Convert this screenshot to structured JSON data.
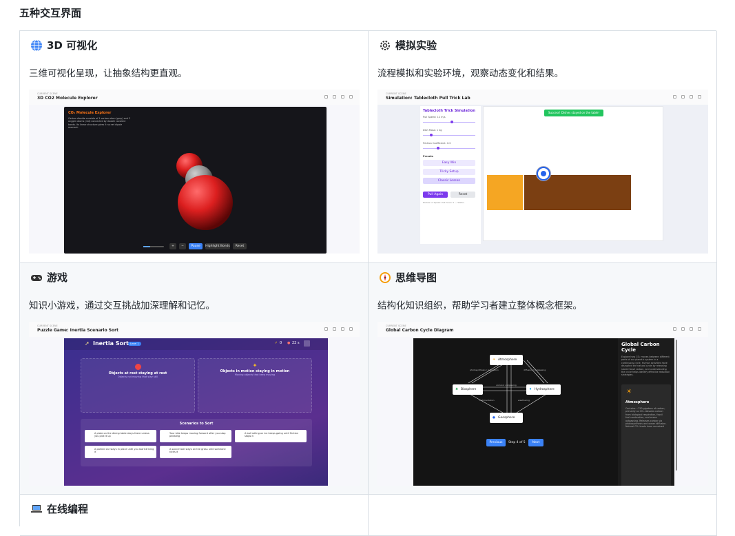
{
  "page_title": "五种交互界面",
  "cells": [
    {
      "title": "3D 可视化",
      "icon": "globe-icon",
      "desc": "三维可视化呈现，让抽象结构更直观。",
      "shot": {
        "subtitle": "CURRENT SCENE",
        "name": "3D CO2 Molecule Explorer",
        "panel_title": "CO₂ Molecule Explorer",
        "panel_text": "Carbon dioxide consists of 1 carbon atom (grey) and 2 oxygen atoms (red) connected by double covalent bonds. Its linear structure gives it no net dipole moment.",
        "buttons": [
          "+",
          "−",
          "Pause",
          "Highlight Bonds",
          "Reset"
        ]
      }
    },
    {
      "title": "模拟实验",
      "icon": "gear-icon",
      "desc": "流程模拟和实验环境，观察动态变化和结果。",
      "shot": {
        "subtitle": "CURRENT SCENE",
        "name": "Simulation: Tablecloth Pull Trick Lab",
        "panel_title": "Tablecloth Trick Simulation",
        "toast": "Success! Dishes stayed on the table!",
        "sliders": [
          "Pull Speed: 12 m/s",
          "Dish Mass: 1 kg",
          "Friction Coefficient: 0.2"
        ],
        "presets_label": "Presets",
        "presets": [
          "Easy Win",
          "Tricky Setup",
          "Classic Lesson"
        ],
        "actions": [
          "Pull Again",
          "Reset"
        ],
        "footer": "Dishes on Speed: Pull Force: 0 — Status"
      }
    },
    {
      "title": "游戏",
      "icon": "gamepad-icon",
      "desc": "知识小游戏，通过交互挑战加深理解和记忆。",
      "shot": {
        "subtitle": "CURRENT SCENE",
        "name": "Puzzle Game: Inertia Scenario Sort",
        "game_title": "Inertia Sort",
        "level": "Level 1",
        "score": "0",
        "timer": "22 s",
        "zones": [
          {
            "title": "Objects at rest staying at rest",
            "sub": "Objects not moving that stay still"
          },
          {
            "title": "Objects in motion staying in motion",
            "sub": "Moving objects that keep moving"
          }
        ],
        "scenarios_title": "Scenarios to Sort",
        "scenarios": [
          "A plate on the dining table stays there unless you pick it up",
          "Your bike keeps moving forward after you stop pedaling",
          "A ball rolling on ice keeps going until friction stops it",
          "A parked car stays in place until you start driving it",
          "A soccer ball stays on the grass until someone kicks it"
        ]
      }
    },
    {
      "title": "思维导图",
      "icon": "compass-icon",
      "desc": "结构化知识组织，帮助学习者建立整体概念框架。",
      "shot": {
        "subtitle": "CURRENT SCENE",
        "name": "Global Carbon Cycle Diagram",
        "nodes": [
          "Atmosphere",
          "Biosphere",
          "Hydrosphere",
          "Geosphere"
        ],
        "edge_labels": [
          "photosynthesis / respiration",
          "diffusion / outgassing",
          "volcanic outgassing",
          "sedimentation",
          "weathering"
        ],
        "nav": [
          "Previous",
          "Step 4 of 5",
          "Next"
        ],
        "side_title": "Global Carbon Cycle",
        "side_text": "Explore how CO₂ moves between different parts of our planet's system in a continuous cycle. Human activities have disrupted the natural cycle by releasing stored fossil carbon, and understanding the cycle helps identify effective reduction strategies.",
        "card_title": "Atmosphere",
        "card_text": "Contains ~750 gigatons of carbon, primarily as CO₂. Absorbs carbon from biological respiration, fossil fuel combustion, and ocean outgassing. Releases carbon via photosynthesis and ocean diffusion. Natural CO₂ levels have remained"
      }
    },
    {
      "title": "在线编程",
      "icon": "laptop-icon",
      "desc": ""
    }
  ],
  "colors": {
    "border": "#d8dee4",
    "alt_bg": "#f6f8fa",
    "purple": "#7c3aed",
    "green": "#22c55e",
    "blue": "#2563eb"
  }
}
